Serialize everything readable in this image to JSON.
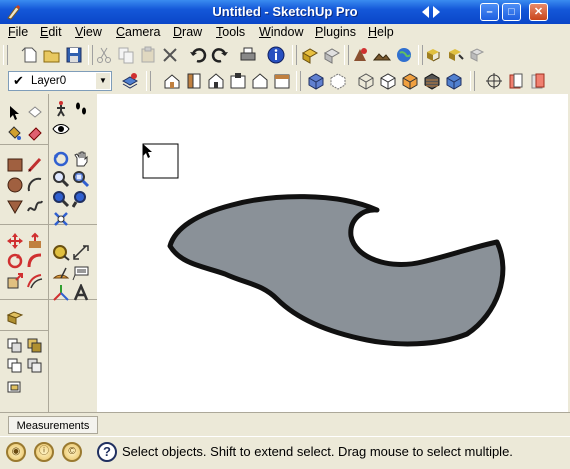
{
  "window": {
    "title": "Untitled - SketchUp Pro",
    "minimize_glyph": "–",
    "maximize_glyph": "□",
    "close_glyph": "✕"
  },
  "menu": {
    "items": [
      {
        "accel": "F",
        "rest": "ile"
      },
      {
        "accel": "E",
        "rest": "dit"
      },
      {
        "accel": "V",
        "rest": "iew"
      },
      {
        "accel": "C",
        "rest": "amera"
      },
      {
        "accel": "D",
        "rest": "raw"
      },
      {
        "accel": "T",
        "rest": "ools"
      },
      {
        "accel": "W",
        "rest": "indow"
      },
      {
        "accel": "P",
        "rest": "lugins"
      },
      {
        "accel": "H",
        "rest": "elp"
      }
    ]
  },
  "layers": {
    "current": "Layer0",
    "check_glyph": "✔",
    "dropdown_glyph": "▼"
  },
  "measurements": {
    "label": "Measurements"
  },
  "status": {
    "text": "Select objects. Shift to extend select. Drag mouse to select multiple.",
    "help_glyph": "?",
    "icons": [
      "geo-location-icon",
      "credits-icon",
      "copyright-icon"
    ]
  },
  "colors": {
    "shape_fill": "#8a9198",
    "shape_stroke": "#111111",
    "title_gradient_top": "#3a8cf0"
  }
}
